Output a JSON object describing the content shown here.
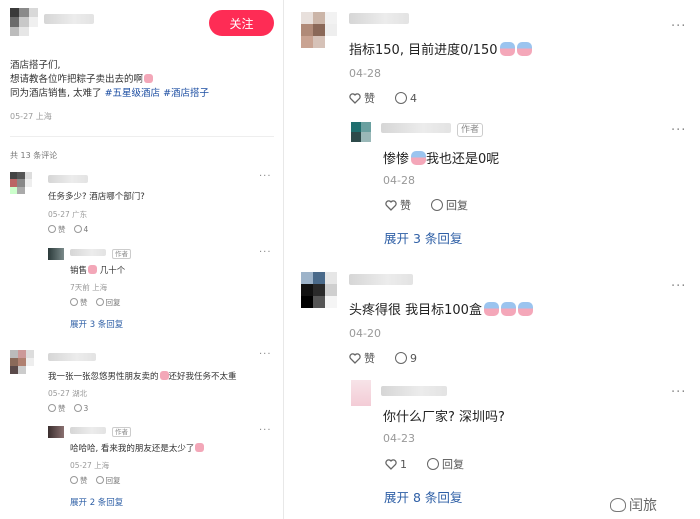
{
  "left": {
    "follow_label": "关注",
    "post_lines": [
      "酒店搭子们,",
      "想请教各位咋把粽子卖出去的啊",
      "同为酒店销售, 太难了"
    ],
    "tags": [
      "#五星级酒店",
      "#酒店搭子"
    ],
    "post_meta": "05-27 上海",
    "comment_count": "共 13 条评论",
    "comments": [
      {
        "text": "任务多少? 酒店哪个部门?",
        "meta": "05-27 广东",
        "like_label": "赞",
        "reply_count": "4",
        "reply": {
          "author_badge": "作者",
          "text": "销售",
          "text2": "几十个",
          "meta": "7天前 上海",
          "like_label": "赞",
          "reply_label": "回复"
        },
        "expand_label": "展开 3 条回复"
      },
      {
        "text": "我一张一张忽悠男性朋友卖的",
        "text2": "还好我任务不太重",
        "meta": "05-27 湖北",
        "like_label": "赞",
        "reply_count": "3",
        "reply": {
          "author_badge": "作者",
          "text": "哈哈哈, 看来我的朋友还是太少了",
          "meta": "05-27 上海",
          "like_label": "赞",
          "reply_label": "回复"
        },
        "expand_label": "展开 2 条回复"
      }
    ]
  },
  "right": {
    "comments": [
      {
        "text": "指标150, 目前进度0/150",
        "meta": "04-28",
        "like_label": "赞",
        "reply_count": "4",
        "reply": {
          "author_badge": "作者",
          "text": "惨惨",
          "text2": "我也还是0呢",
          "meta": "04-28",
          "like_label": "赞",
          "reply_label": "回复"
        },
        "expand_label": "展开 3 条回复"
      },
      {
        "text": "头疼得很 我目标100盒",
        "meta": "04-20",
        "like_label": "赞",
        "reply_count": "9",
        "reply": {
          "text": "你什么厂家? 深圳吗?",
          "meta": "04-23",
          "like_count": "1",
          "reply_label": "回复"
        },
        "expand_label": "展开 8 条回复"
      }
    ]
  },
  "watermark": "闰旅",
  "colors": {
    "accent": "#fe2c55",
    "link": "#2e5fa6",
    "tag": "#1e4fa3"
  },
  "icons": [
    "more-dots-icon",
    "heart-icon",
    "comment-icon",
    "emoji-icon",
    "weibo-logo-icon"
  ]
}
